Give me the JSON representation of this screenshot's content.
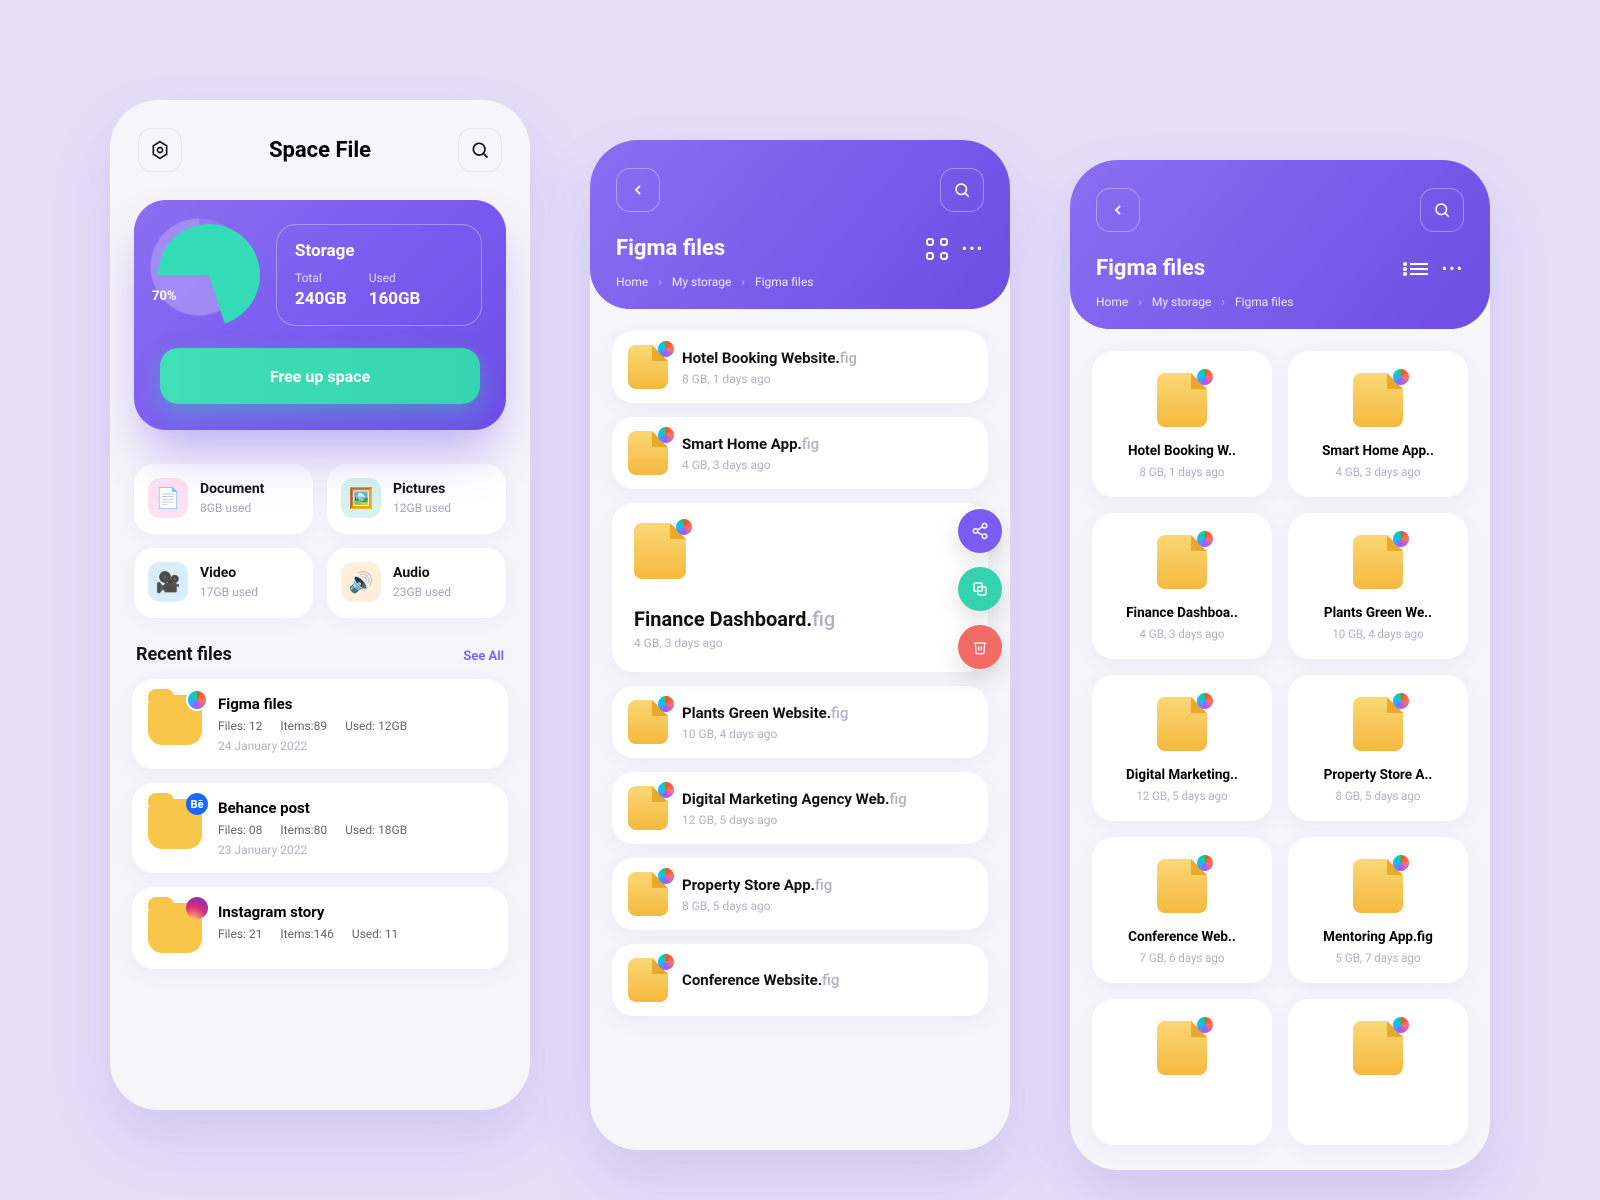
{
  "app_title": "Space File",
  "storage": {
    "title": "Storage",
    "percent": "70%",
    "total_label": "Total",
    "total_value": "240GB",
    "used_label": "Used",
    "used_value": "160GB",
    "free_button": "Free up space"
  },
  "categories": [
    {
      "name": "Document",
      "used": "8GB used"
    },
    {
      "name": "Pictures",
      "used": "12GB used"
    },
    {
      "name": "Video",
      "used": "17GB used"
    },
    {
      "name": "Audio",
      "used": "23GB used"
    }
  ],
  "recent": {
    "title": "Recent files",
    "see_all": "See All",
    "items": [
      {
        "name": "Figma files",
        "files": "Files: 12",
        "items": "Items:89",
        "used": "Used: 12GB",
        "date": "24 January 2022"
      },
      {
        "name": "Behance post",
        "files": "Files: 08",
        "items": "Items:80",
        "used": "Used: 18GB",
        "date": "23 January 2022"
      },
      {
        "name": "Instagram story",
        "files": "Files: 21",
        "items": "Items:146",
        "used": "Used: 11",
        "date": ""
      }
    ]
  },
  "folder": {
    "title": "Figma files",
    "crumbs": [
      "Home",
      "My storage",
      "Figma files"
    ]
  },
  "files": [
    {
      "name": "Hotel Booking Website.",
      "ext": "fig",
      "meta": "8 GB, 1 days ago",
      "short": "Hotel Booking W.."
    },
    {
      "name": "Smart Home App.",
      "ext": "fig",
      "meta": "4 GB, 3 days ago",
      "short": "Smart Home App.."
    },
    {
      "name": "Finance Dashboard.",
      "ext": "fig",
      "meta": "4 GB, 3 days ago",
      "short": "Finance Dashboa.."
    },
    {
      "name": "Plants Green Website.",
      "ext": "fig",
      "meta": "10 GB, 4 days ago",
      "short": "Plants Green We.."
    },
    {
      "name": "Digital Marketing Agency Web.",
      "ext": "fig",
      "meta": "12 GB, 5 days ago",
      "short": "Digital Marketing.."
    },
    {
      "name": "Property Store App.",
      "ext": "fig",
      "meta": "8 GB, 5 days ago",
      "short": "Property Store A.."
    },
    {
      "name": "Conference Website.",
      "ext": "fig",
      "meta": "7 GB, 6 days ago",
      "short": "Conference Web.."
    },
    {
      "name": "Mentoring App.",
      "ext": "fig",
      "meta": "5 GB, 7 days ago",
      "short": "Mentoring App.fig"
    }
  ]
}
